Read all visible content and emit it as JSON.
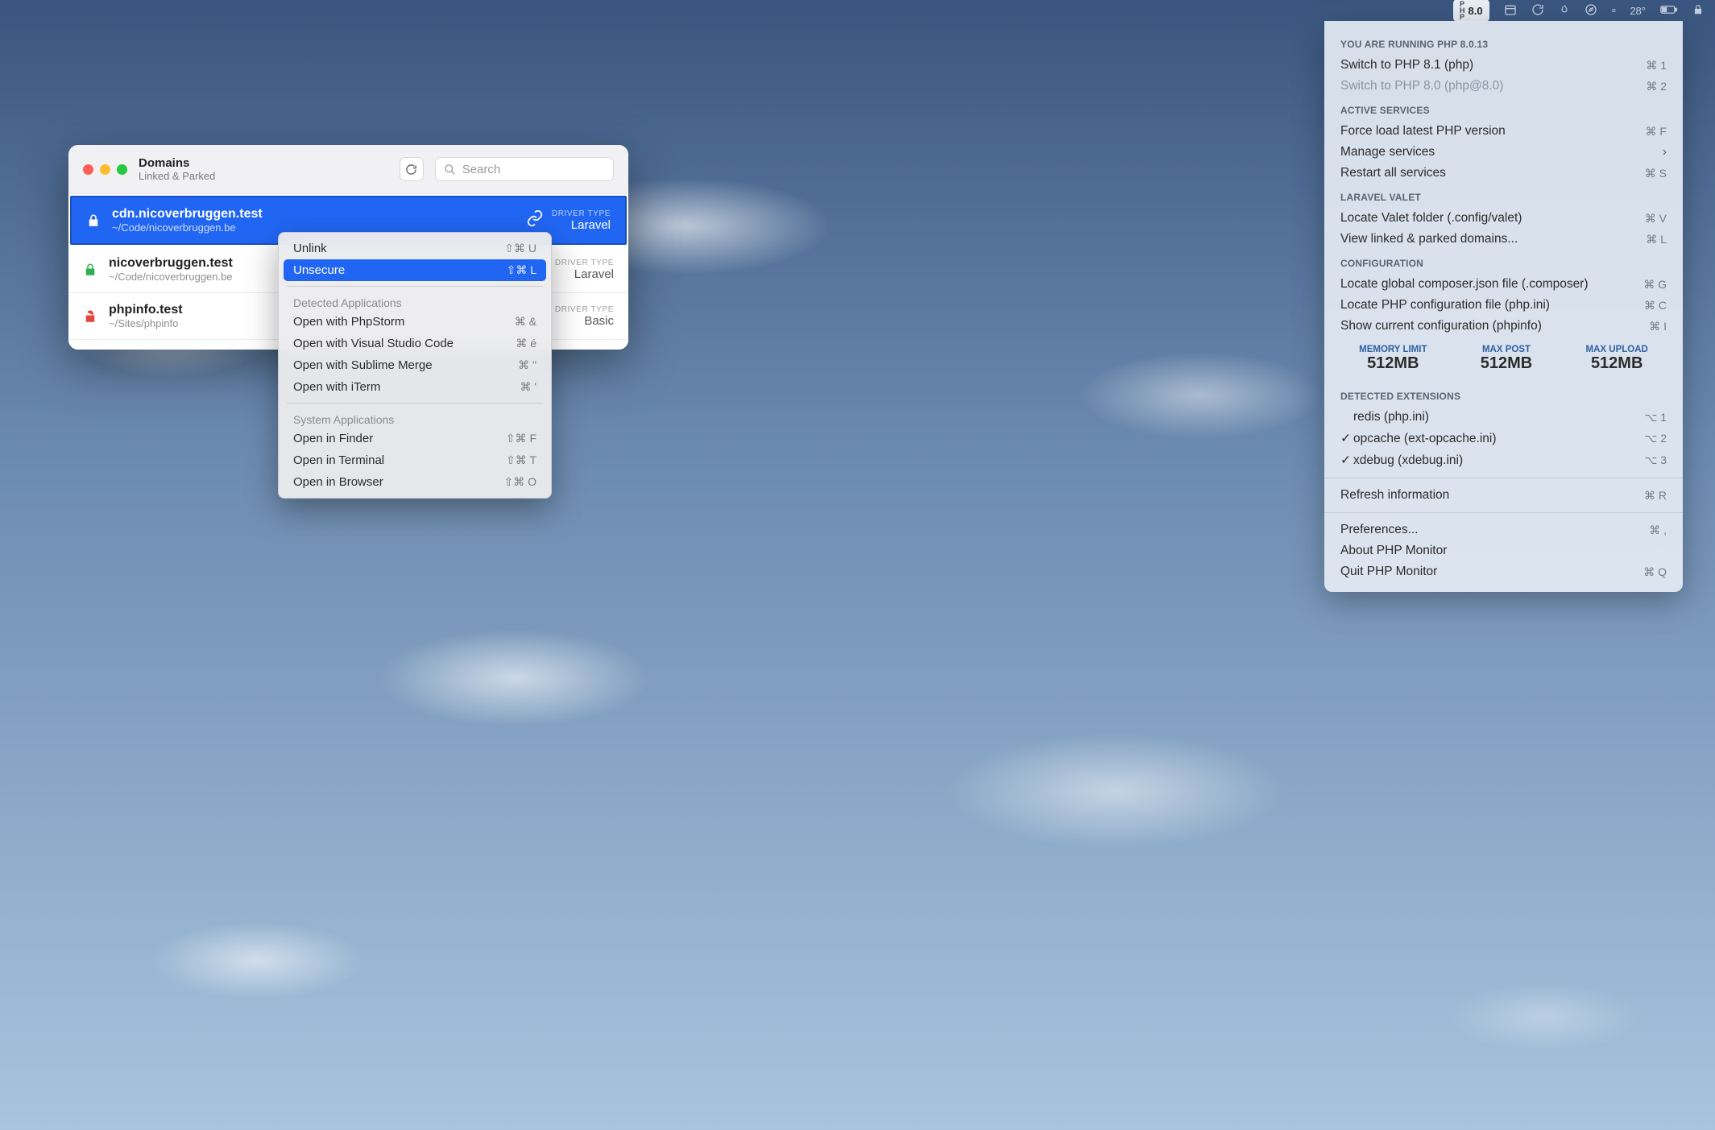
{
  "menubar": {
    "php_version": "8.0",
    "temperature": "28°"
  },
  "dropdown": {
    "header_running": "YOU ARE RUNNING PHP 8.0.13",
    "switch_items": [
      {
        "label": "Switch to PHP 8.1 (php)",
        "shortcut": "⌘ 1",
        "disabled": false
      },
      {
        "label": "Switch to PHP 8.0 (php@8.0)",
        "shortcut": "⌘ 2",
        "disabled": true
      }
    ],
    "services_header": "ACTIVE SERVICES",
    "services_items": [
      {
        "label": "Force load latest PHP version",
        "shortcut": "⌘ F"
      },
      {
        "label": "Manage services",
        "has_submenu": true
      },
      {
        "label": "Restart all services",
        "shortcut": "⌘ S"
      }
    ],
    "valet_header": "LARAVEL VALET",
    "valet_items": [
      {
        "label": "Locate Valet folder (.config/valet)",
        "shortcut": "⌘ V"
      },
      {
        "label": "View linked & parked domains...",
        "shortcut": "⌘ L"
      }
    ],
    "config_header": "CONFIGURATION",
    "config_items": [
      {
        "label": "Locate global composer.json file (.composer)",
        "shortcut": "⌘ G"
      },
      {
        "label": "Locate PHP configuration file (php.ini)",
        "shortcut": "⌘ C"
      },
      {
        "label": "Show current configuration (phpinfo)",
        "shortcut": "⌘ I"
      }
    ],
    "stats": {
      "memory_limit_label": "MEMORY LIMIT",
      "memory_limit_value": "512MB",
      "max_post_label": "MAX POST",
      "max_post_value": "512MB",
      "max_upload_label": "MAX UPLOAD",
      "max_upload_value": "512MB"
    },
    "ext_header": "DETECTED EXTENSIONS",
    "extensions": [
      {
        "checked": false,
        "label": "redis (php.ini)",
        "shortcut": "⌥ 1"
      },
      {
        "checked": true,
        "label": "opcache (ext-opcache.ini)",
        "shortcut": "⌥ 2"
      },
      {
        "checked": true,
        "label": "xdebug (xdebug.ini)",
        "shortcut": "⌥ 3"
      }
    ],
    "footer": [
      {
        "label": "Refresh information",
        "shortcut": "⌘ R"
      }
    ],
    "footer2": [
      {
        "label": "Preferences...",
        "shortcut": "⌘ ,"
      },
      {
        "label": "About PHP Monitor",
        "shortcut": ""
      },
      {
        "label": "Quit PHP Monitor",
        "shortcut": "⌘ Q"
      }
    ]
  },
  "window": {
    "title": "Domains",
    "subtitle": "Linked & Parked",
    "search_placeholder": "Search",
    "driver_type_label": "DRIVER TYPE",
    "rows": [
      {
        "domain": "cdn.nicoverbruggen.test",
        "path": "~/Code/nicoverbruggen.be",
        "driver": "Laravel",
        "lock_color": "#ffffff",
        "selected": true,
        "linked": true
      },
      {
        "domain": "nicoverbruggen.test",
        "path": "~/Code/nicoverbruggen.be",
        "driver": "Laravel",
        "lock_color": "#2bb150",
        "selected": false,
        "linked": false
      },
      {
        "domain": "phpinfo.test",
        "path": "~/Sites/phpinfo",
        "driver": "Basic",
        "lock_color": "#e4453a",
        "selected": false,
        "linked": false
      }
    ]
  },
  "context_menu": {
    "items_top": [
      {
        "label": "Unlink",
        "shortcut": "⇧⌘ U",
        "highlighted": false
      },
      {
        "label": "Unsecure",
        "shortcut": "⇧⌘ L",
        "highlighted": true
      }
    ],
    "section_detected": "Detected Applications",
    "items_detected": [
      {
        "label": "Open with PhpStorm",
        "shortcut": "⌘ &"
      },
      {
        "label": "Open with Visual Studio Code",
        "shortcut": "⌘ é"
      },
      {
        "label": "Open with Sublime Merge",
        "shortcut": "⌘ \""
      },
      {
        "label": "Open with iTerm",
        "shortcut": "⌘ '"
      }
    ],
    "section_system": "System Applications",
    "items_system": [
      {
        "label": "Open in Finder",
        "shortcut": "⇧⌘ F"
      },
      {
        "label": "Open in Terminal",
        "shortcut": "⇧⌘ T"
      },
      {
        "label": "Open in Browser",
        "shortcut": "⇧⌘ O"
      }
    ]
  }
}
